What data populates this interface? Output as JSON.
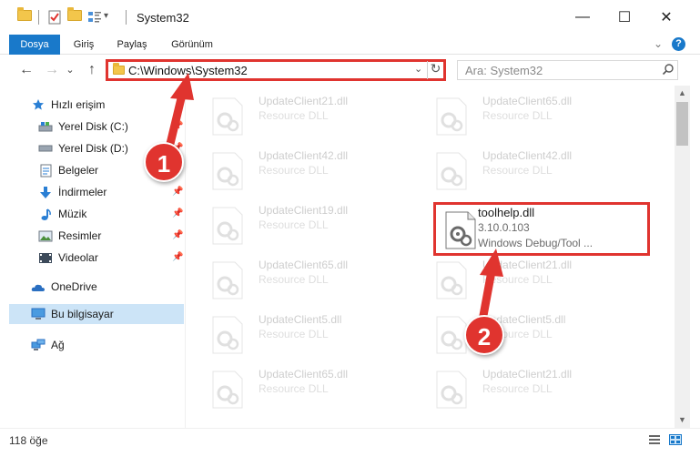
{
  "window": {
    "title": "System32",
    "minimize_glyph": "—",
    "maximize_glyph": "☐",
    "close_glyph": "✕"
  },
  "quick_access_toolbar": {
    "dropdown_glyph": "▾"
  },
  "ribbon": {
    "tabs": [
      {
        "label": "Dosya",
        "active": true
      },
      {
        "label": "Giriş",
        "active": false
      },
      {
        "label": "Paylaş",
        "active": false
      },
      {
        "label": "Görünüm",
        "active": false
      }
    ],
    "expand_glyph": "⌄",
    "help_glyph": "?"
  },
  "navigation": {
    "back_glyph": "←",
    "forward_glyph": "→",
    "recent_glyph": "⌄",
    "up_glyph": "↑"
  },
  "address_bar": {
    "path": "C:\\Windows\\System32",
    "dropdown_glyph": "⌄",
    "refresh_glyph": "↻"
  },
  "search": {
    "placeholder": "Ara: System32"
  },
  "nav_pane": {
    "items": [
      {
        "label": "Hızlı erişim",
        "icon": "star-icon"
      },
      {
        "label": "Yerel Disk (C:)",
        "icon": "drive-icon",
        "pinned": true
      },
      {
        "label": "Yerel Disk (D:)",
        "icon": "drive-icon",
        "pinned": true
      },
      {
        "label": "Belgeler",
        "icon": "documents-icon",
        "pinned": true
      },
      {
        "label": "İndirmeler",
        "icon": "download-icon",
        "pinned": true
      },
      {
        "label": "Müzik",
        "icon": "music-icon",
        "pinned": true
      },
      {
        "label": "Resimler",
        "icon": "pictures-icon",
        "pinned": true
      },
      {
        "label": "Videolar",
        "icon": "videos-icon",
        "pinned": true
      },
      {
        "label": "OneDrive",
        "icon": "onedrive-icon"
      },
      {
        "label": "Bu bilgisayar",
        "icon": "computer-icon",
        "selected": true
      },
      {
        "label": "Ağ",
        "icon": "network-icon"
      }
    ],
    "pin_glyph": "📌"
  },
  "files": [
    {
      "name": "UpdateClient21.dll",
      "type": "Resource DLL"
    },
    {
      "name": "UpdateClient65.dll",
      "type": "Resource DLL"
    },
    {
      "name": "UpdateClient42.dll",
      "type": "Resource DLL"
    },
    {
      "name": "UpdateClient42.dll",
      "type": "Resource DLL"
    },
    {
      "name": "UpdateClient19.dll",
      "type": "Resource DLL"
    },
    {
      "name": "toolhelp.dll",
      "version": "3.10.0.103",
      "description": "Windows Debug/Tool ...",
      "highlighted": true
    },
    {
      "name": "UpdateClient65.dll",
      "type": "Resource DLL"
    },
    {
      "name": "UpdateClient21.dll",
      "type": "Resource DLL"
    },
    {
      "name": "UpdateClient5.dll",
      "type": "Resource DLL"
    },
    {
      "name": "UpdateClient5.dll",
      "type": "Resource DLL"
    },
    {
      "name": "UpdateClient65.dll",
      "type": "Resource DLL"
    },
    {
      "name": "UpdateClient21.dll",
      "type": "Resource DLL"
    }
  ],
  "scrollbar": {
    "up_glyph": "▲",
    "down_glyph": "▼"
  },
  "status_bar": {
    "item_count": "118 öğe"
  },
  "annotations": [
    {
      "number": "1"
    },
    {
      "number": "2"
    }
  ],
  "colors": {
    "accent": "#1979ca",
    "annotation_red": "#e0342f",
    "selection": "#cce4f7"
  }
}
